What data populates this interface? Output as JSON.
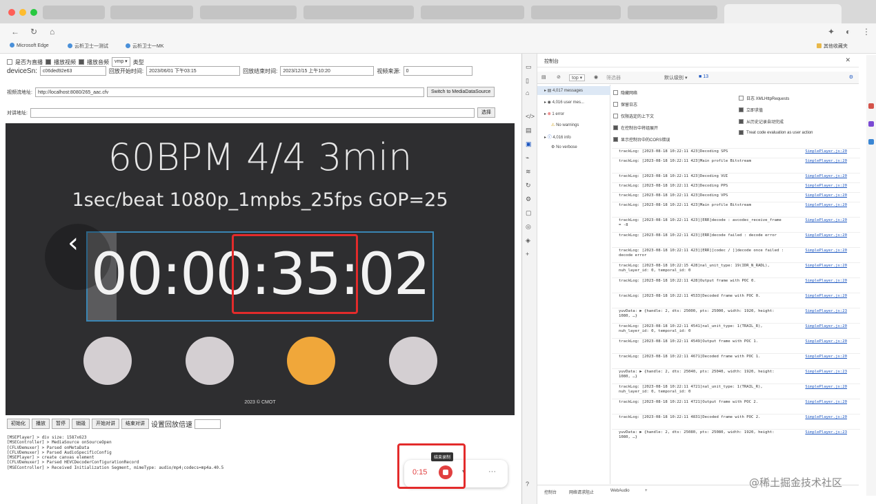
{
  "browser": {
    "bookmarks": [
      "Microsoft Edge",
      "云析卫士一测试",
      "云析卫士一MK",
      "其他收藏夹"
    ]
  },
  "controls": {
    "checkbox_live": "是否为直播",
    "checkbox_video": "播放视频",
    "checkbox_audio": "播放音频",
    "type_select": "vmp",
    "type_label": "类型",
    "device_label": "deviceSn:",
    "device_value": "c06ded92e63",
    "start_label": "回放开始时间:",
    "start_value": "2023/06/01 下午03:15",
    "end_label": "回放结束时间:",
    "end_value": "2023/12/15 上午10:20",
    "source_label": "视频来源:",
    "source_value": "0",
    "stream_label": "视频流地址:",
    "stream_value": "http://localhost:8080/265_aac.cfv",
    "switch_button": "Switch to MediaDataSource",
    "talk_label": "对讲地址:",
    "talk_value": "",
    "select_button": "选择"
  },
  "video": {
    "title": "60BPM 4/4 3min",
    "subtitle": "1sec/beat  1080p_1mpbs_25fps GOP=25",
    "timecode": "00:00:35:02",
    "copyright": "2023 © CMOT",
    "dot_colors": [
      "#d4cfd2",
      "#d4cfd2",
      "#f0a73a",
      "#d4cfd2"
    ],
    "prev_glyph": "‹"
  },
  "player_buttons": [
    "初始化",
    "播放",
    "暂停",
    "销毁",
    "开始对讲",
    "结束对讲"
  ],
  "playback_speed_label": "设置回放倍速",
  "log_lines": [
    "[MSEPlayer] > div size: 1587x623",
    "[MSEController] > MediaSource onSourceOpen",
    "[CFLVDemuxer] > Parsed onMetaData",
    "[CFLVDemuxer] > Parsed AudioSpecificConfig",
    "[MSEPlayer] > create canvas element",
    "[CFLVDemuxer] > Parsed HEVCDecoderConfigurationRecord",
    "[MSEController] > Received Initialization Segment, mimeType: audio/mp4;codecs=mp4a.40.5"
  ],
  "recorder": {
    "time": "0:15",
    "tooltip": "结束录制",
    "more": "···"
  },
  "devtools": {
    "title": "控制台",
    "filter": {
      "context": "top",
      "filter_placeholder": "筛选器",
      "levels": "默认级别",
      "issues": "13"
    },
    "sidebar": [
      {
        "count": "4,017",
        "label": "messages"
      },
      {
        "count": "4,016",
        "label": "user mes..."
      },
      {
        "count": "1",
        "label": "error"
      },
      {
        "count": "",
        "label": "No warnings"
      },
      {
        "count": "4,016",
        "label": "info"
      },
      {
        "count": "",
        "label": "No verbose"
      }
    ],
    "settings_left": [
      "隐藏网络",
      "保留日志",
      "仅限选定的上下文",
      "在控制台中将组展开",
      "显示控制台中的CORS错误"
    ],
    "settings_left_checked": [
      false,
      false,
      false,
      true,
      true
    ],
    "settings_right": [
      "日志 XMLHttpRequests",
      "立即求值",
      "从历史记录自动完成",
      "Treat code evaluation as user action"
    ],
    "settings_right_checked": [
      false,
      true,
      true,
      true
    ],
    "console_lines": [
      {
        "msg": "trackLog: [2023-08-18 10:22:11 423]Decoding SPS",
        "src": "SimplePlayer.js:20"
      },
      {
        "msg": "trackLog: [2023-08-18 10:22:11 423]Main profile Bitstream",
        "src": "SimplePlayer.js:20"
      },
      {
        "msg": "trackLog: [2023-08-18 10:22:11 423]Decoding VUI",
        "src": "SimplePlayer.js:20"
      },
      {
        "msg": "trackLog: [2023-08-18 10:22:11 423]Decoding PPS",
        "src": "SimplePlayer.js:20"
      },
      {
        "msg": "trackLog: [2023-08-18 10:22:11 423]Decoding VPS",
        "src": "SimplePlayer.js:20"
      },
      {
        "msg": "trackLog: [2023-08-18 10:22:11 423]Main profile Bitstream",
        "src": "SimplePlayer.js:20"
      },
      {
        "msg": "trackLog: [2023-08-18 10:22:11 423][ERR]decode : avcodec_receive_frame = -8",
        "src": "SimplePlayer.js:20"
      },
      {
        "msg": "trackLog: [2023-08-18 10:22:11 423][ERR]decode failed : decode error",
        "src": "SimplePlayer.js:20"
      },
      {
        "msg": "trackLog: [2023-08-18 10:22:11 423][ERR][codec / ]]decode once failed : decode error",
        "src": "SimplePlayer.js:20"
      },
      {
        "msg": "trackLog: [2023-08-18 10:22:15 428]nal_unit_type: 19(IDR_N_RADL), nuh_layer_id: 0, temporal_id: 0",
        "src": "SimplePlayer.js:20"
      },
      {
        "msg": "trackLog: [2023-08-18 10:22:11 428]Output frame with POC 0.",
        "src": "SimplePlayer.js:20"
      },
      {
        "msg": "trackLog: [2023-08-18 10:22:11 4533]Decoded frame with POC 0.",
        "src": "SimplePlayer.js:20"
      },
      {
        "msg": "yuvData: ▶ {handle: 2, dts: 25000, pts: 25000, width: 1920, height: 1080, …}",
        "src": "SimplePlayer.js:23"
      },
      {
        "msg": "trackLog: [2023-08-18 10:22:11 4541]nal_unit_type: 1(TRAIL_R), nuh_layer_id: 0, temporal_id: 0",
        "src": "SimplePlayer.js:20"
      },
      {
        "msg": "trackLog: [2023-08-18 10:22:11 4549]Output frame with POC 1.",
        "src": "SimplePlayer.js:20"
      },
      {
        "msg": "trackLog: [2023-08-18 10:22:11 4671]Decoded frame with POC 1.",
        "src": "SimplePlayer.js:20"
      },
      {
        "msg": "yuvData: ▶ {handle: 2, dts: 25040, pts: 25040, width: 1920, height: 1080, …}",
        "src": "SimplePlayer.js:23"
      },
      {
        "msg": "trackLog: [2023-08-18 10:22:11 4721]nal_unit_type: 1(TRAIL_R), nuh_layer_id: 0, temporal_id: 0",
        "src": "SimplePlayer.js:20"
      },
      {
        "msg": "trackLog: [2023-08-18 10:22:11 4721]Output frame with POC 2.",
        "src": "SimplePlayer.js:20"
      },
      {
        "msg": "trackLog: [2023-08-18 10:22:11 4831]Decoded frame with POC 2.",
        "src": "SimplePlayer.js:20"
      },
      {
        "msg": "yuvData: ▶ {handle: 2, dts: 25080, pts: 25080, width: 1920, height: 1080, …}",
        "src": "SimplePlayer.js:23"
      }
    ],
    "bottom_tabs": [
      "控制台",
      "网络请求阻止",
      "WebAudio"
    ]
  },
  "watermark": "@稀土掘金技术社区",
  "colors": {
    "video_bg": "#2e2e30",
    "timebox_border": "#3a86b5",
    "highlight_red": "#e32b2b",
    "link_blue": "#1a55c0"
  }
}
